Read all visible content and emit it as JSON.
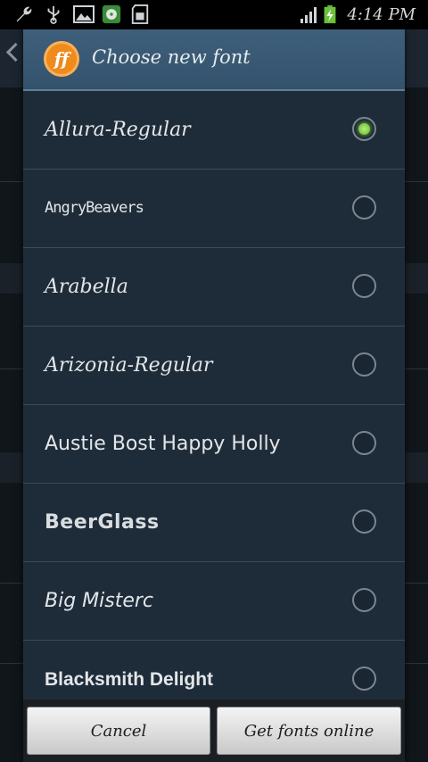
{
  "status_bar": {
    "time": "4:14 PM",
    "icons": [
      "wrench-icon",
      "usb-icon",
      "picture-icon",
      "media-icon",
      "sd-card-icon",
      "signal-icon",
      "battery-charging-icon"
    ]
  },
  "dialog": {
    "title": "Choose new font",
    "logo_text": "ff",
    "fonts": [
      {
        "label": "Allura-Regular",
        "selected": true
      },
      {
        "label": "AngryBeavers",
        "selected": false
      },
      {
        "label": "Arabella",
        "selected": false
      },
      {
        "label": "Arizonia-Regular",
        "selected": false
      },
      {
        "label": "Austie Bost Happy Holly",
        "selected": false
      },
      {
        "label": "BeerGlass",
        "selected": false
      },
      {
        "label": "Big Misterc",
        "selected": false
      },
      {
        "label": "Blacksmith Delight",
        "selected": false
      }
    ],
    "buttons": {
      "cancel": "Cancel",
      "get_fonts": "Get fonts online"
    }
  },
  "colors": {
    "header": "#3e5f7b",
    "list_bg": "#1e2c3a",
    "radio_selected": "#7ed34a",
    "logo": "#ef8a1d"
  }
}
